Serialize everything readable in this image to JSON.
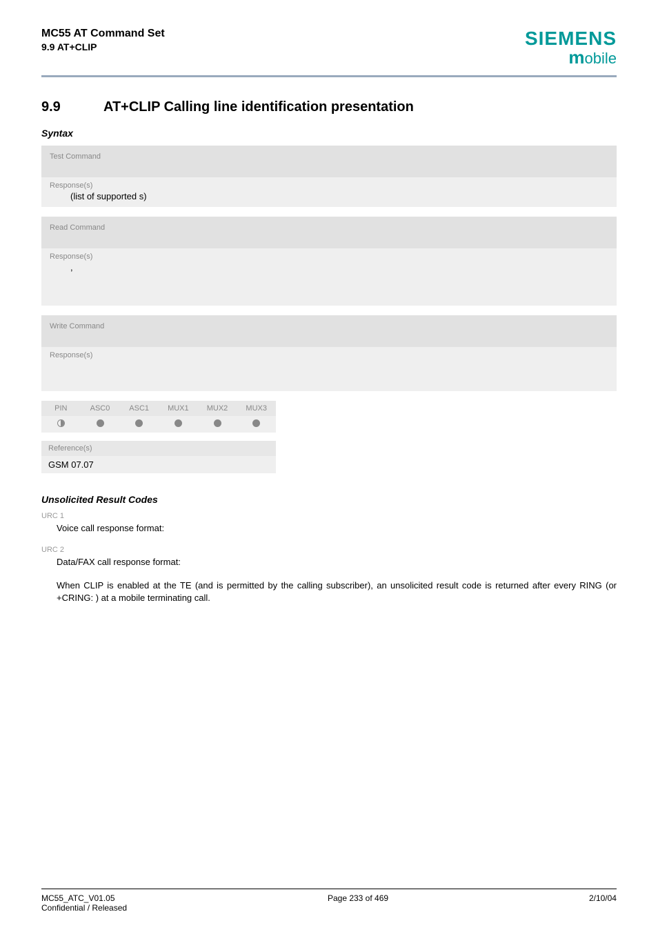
{
  "header": {
    "title": "MC55 AT Command Set",
    "subtitle": "9.9 AT+CLIP",
    "logo_main": "SIEMENS",
    "logo_sub_m": "m",
    "logo_sub_rest": "obile"
  },
  "section": {
    "number": "9.9",
    "title": "AT+CLIP   Calling line identification presentation"
  },
  "syntax_label": "Syntax",
  "blocks": {
    "test": {
      "head": "Test Command",
      "resp_label": "Response(s)",
      "line": "(list of supported       s)"
    },
    "read": {
      "head": "Read Command",
      "resp_label": "Response(s)",
      "line": ", "
    },
    "write": {
      "head": "Write Command",
      "resp_label": "Response(s)"
    }
  },
  "matrix": {
    "cols": [
      "PIN",
      "ASC0",
      "ASC1",
      "MUX1",
      "MUX2",
      "MUX3"
    ]
  },
  "reference": {
    "head": "Reference(s)",
    "body": "GSM 07.07"
  },
  "urc": {
    "label": "Unsolicited Result Codes",
    "u1_num": "URC 1",
    "u1_text": "Voice call response format:",
    "u2_num": "URC 2",
    "u2_text": "Data/FAX call response format:",
    "para": "When CLIP is enabled at the TE (and is permitted by the calling subscriber), an unsolicited result code is returned after every RING (or +CRING:               ) at a mobile terminating call."
  },
  "footer": {
    "left1": "MC55_ATC_V01.05",
    "left2": "Confidential / Released",
    "center": "Page 233 of 469",
    "right": "2/10/04"
  }
}
